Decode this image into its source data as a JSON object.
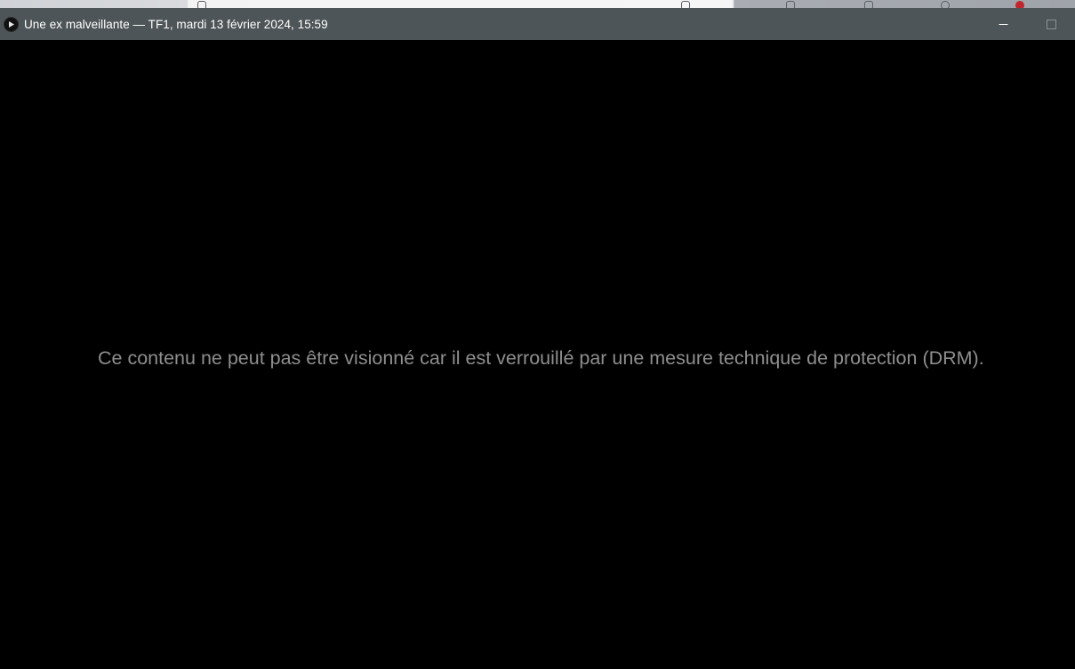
{
  "window": {
    "title": "Une ex malveillante — TF1, mardi 13 février 2024, 15:59",
    "icon": "play-icon"
  },
  "controls": {
    "minimize_icon": "minimize-icon",
    "maximize_icon": "maximize-icon"
  },
  "player": {
    "drm_message": "Ce contenu ne peut pas être visionné car il est verrouillé par une mesure technique de protection (DRM)."
  },
  "colors": {
    "titlebar": "#4e5558",
    "title_text": "#ffffff",
    "video_background": "#000000",
    "message_text": "#8e8e8e"
  }
}
